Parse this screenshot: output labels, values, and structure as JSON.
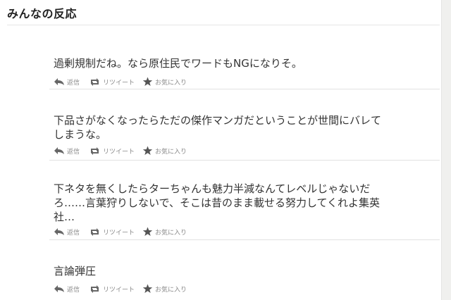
{
  "section": {
    "title": "みんなの反応"
  },
  "actions": {
    "reply": "返信",
    "retweet": "リツイート",
    "favorite": "お気に入り"
  },
  "tweets": [
    {
      "text": "過剰規制だね。なら原住民でワードもNGになりそ。"
    },
    {
      "text": "下品さがなくなったらただの傑作マンガだということが世間にバレてしまうな。"
    },
    {
      "text": "下ネタを無くしたらターちゃんも魅力半減なんてレベルじゃないだろ……言葉狩りしないで、そこは昔のまま載せる努力してくれよ集英社…"
    },
    {
      "text": "言論弾圧"
    }
  ]
}
